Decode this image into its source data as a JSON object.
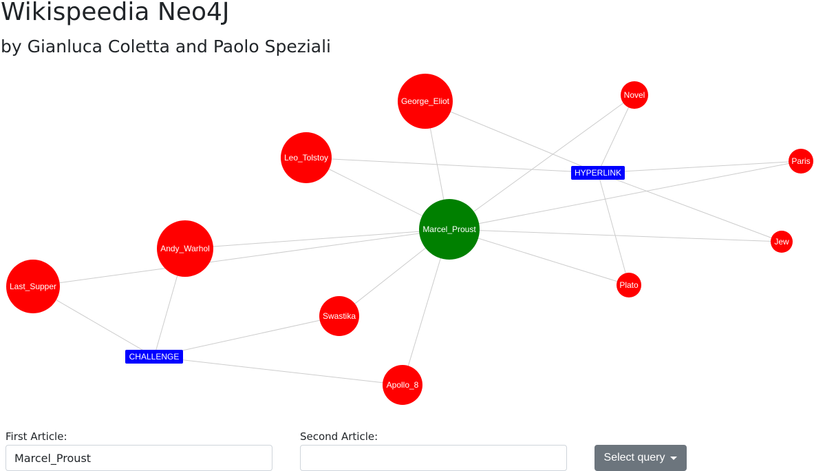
{
  "header": {
    "title": "Wikispeedia Neo4J",
    "subtitle": "by Gianluca Coletta and Paolo Speziali"
  },
  "graph": {
    "colors": {
      "article": "#ff0000",
      "source": "#008000",
      "relation": "#0000ff",
      "edge": "#cccccc"
    },
    "nodes": [
      {
        "id": "george_eliot",
        "label": "George_Eliot",
        "type": "article"
      },
      {
        "id": "novel",
        "label": "Novel",
        "type": "article"
      },
      {
        "id": "leo_tolstoy",
        "label": "Leo_Tolstoy",
        "type": "article"
      },
      {
        "id": "paris",
        "label": "Paris",
        "type": "article"
      },
      {
        "id": "marcel_proust",
        "label": "Marcel_Proust",
        "type": "source"
      },
      {
        "id": "andy_warhol",
        "label": "Andy_Warhol",
        "type": "article"
      },
      {
        "id": "jew",
        "label": "Jew",
        "type": "article"
      },
      {
        "id": "last_supper",
        "label": "Last_Supper",
        "type": "article"
      },
      {
        "id": "plato",
        "label": "Plato",
        "type": "article"
      },
      {
        "id": "swastika",
        "label": "Swastika",
        "type": "article"
      },
      {
        "id": "apollo_8",
        "label": "Apollo_8",
        "type": "article"
      },
      {
        "id": "hyperlink",
        "label": "HYPERLINK",
        "type": "relation"
      },
      {
        "id": "challenge",
        "label": "CHALLENGE",
        "type": "relation"
      }
    ],
    "edges": [
      [
        "george_eliot",
        "marcel_proust"
      ],
      [
        "george_eliot",
        "hyperlink"
      ],
      [
        "leo_tolstoy",
        "marcel_proust"
      ],
      [
        "leo_tolstoy",
        "hyperlink"
      ],
      [
        "novel",
        "marcel_proust"
      ],
      [
        "novel",
        "hyperlink"
      ],
      [
        "hyperlink",
        "paris"
      ],
      [
        "hyperlink",
        "jew"
      ],
      [
        "hyperlink",
        "plato"
      ],
      [
        "paris",
        "marcel_proust"
      ],
      [
        "marcel_proust",
        "jew"
      ],
      [
        "marcel_proust",
        "plato"
      ],
      [
        "marcel_proust",
        "andy_warhol"
      ],
      [
        "marcel_proust",
        "last_supper"
      ],
      [
        "marcel_proust",
        "swastika"
      ],
      [
        "marcel_proust",
        "apollo_8"
      ],
      [
        "andy_warhol",
        "challenge"
      ],
      [
        "last_supper",
        "challenge"
      ],
      [
        "swastika",
        "challenge"
      ],
      [
        "apollo_8",
        "challenge"
      ]
    ]
  },
  "form": {
    "first_article_label": "First Article:",
    "first_article_value": "Marcel_Proust",
    "first_article_placeholder": "",
    "second_article_label": "Second Article:",
    "second_article_value": "",
    "second_article_placeholder": "",
    "select_query_label": "Select query",
    "select_query_icon": "chevron-down-icon"
  }
}
